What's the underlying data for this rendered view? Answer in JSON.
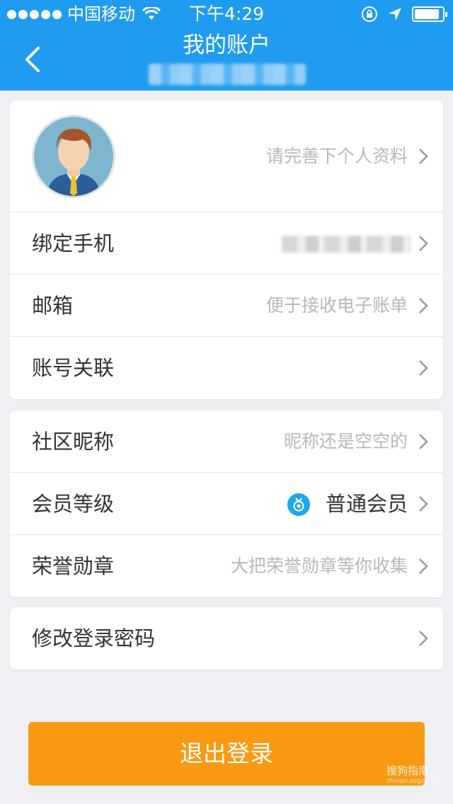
{
  "status_bar": {
    "carrier": "中国移动",
    "time": "下午4:29",
    "battery_level": 0.9
  },
  "header": {
    "title": "我的账户"
  },
  "profile": {
    "prompt": "请完善下个人资料"
  },
  "account_section": [
    {
      "label": "绑定手机",
      "value": ""
    },
    {
      "label": "邮箱",
      "value": "便于接收电子账单"
    },
    {
      "label": "账号关联",
      "value": ""
    }
  ],
  "community_section": [
    {
      "label": "社区昵称",
      "value": "昵称还是空空的"
    },
    {
      "label": "会员等级",
      "value": "普通会员"
    },
    {
      "label": "荣誉勋章",
      "value": "大把荣誉勋章等你收集"
    }
  ],
  "security_section": [
    {
      "label": "修改登录密码",
      "value": ""
    }
  ],
  "logout_label": "退出登录",
  "watermark": {
    "text": "搜狗指南",
    "sub": "zhinan.sogou.com"
  },
  "colors": {
    "header": "#1f9cf0",
    "logout": "#f99a12",
    "background": "#efeff4",
    "medal": "#1fa8e6"
  }
}
